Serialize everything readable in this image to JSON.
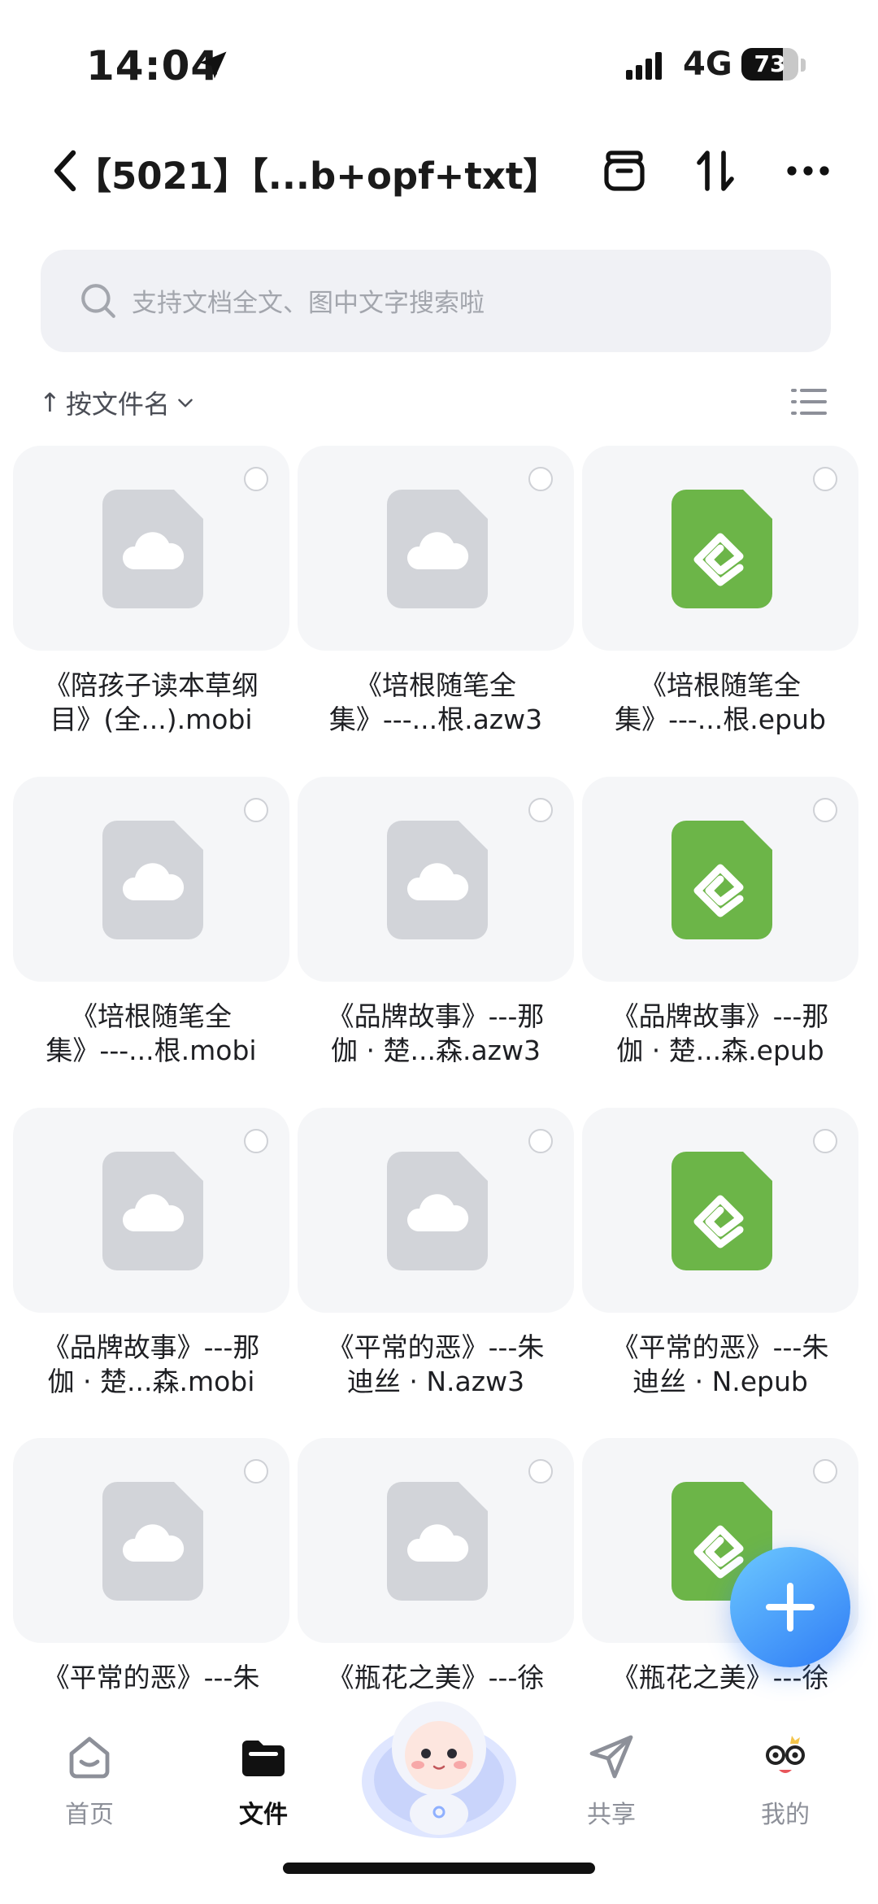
{
  "status": {
    "time": "14:04",
    "network": "4G",
    "battery": "73",
    "battery_level": 0.73
  },
  "header": {
    "title": "【5021】【...b+opf+txt】",
    "icons": [
      "back-chevron-icon",
      "archive-box-icon",
      "sort-arrows-icon",
      "more-dots-icon"
    ]
  },
  "search": {
    "placeholder": "支持文档全文、图中文字搜索啦"
  },
  "sortbar": {
    "arrow": "↑",
    "label": "按文件名"
  },
  "files": [
    {
      "name_line1": "《陪孩子读本草纲",
      "name_line2": "目》(全...).mobi",
      "type": "cloud"
    },
    {
      "name_line1": "《培根随笔全",
      "name_line2": "集》---...根.azw3",
      "type": "cloud"
    },
    {
      "name_line1": "《培根随笔全",
      "name_line2": "集》---...根.epub",
      "type": "epub"
    },
    {
      "name_line1": "《培根随笔全",
      "name_line2": "集》---...根.mobi",
      "type": "cloud"
    },
    {
      "name_line1": "《品牌故事》---那",
      "name_line2": "伽 · 楚...森.azw3",
      "type": "cloud"
    },
    {
      "name_line1": "《品牌故事》---那",
      "name_line2": "伽 · 楚...森.epub",
      "type": "epub"
    },
    {
      "name_line1": "《品牌故事》---那",
      "name_line2": "伽 · 楚...森.mobi",
      "type": "cloud"
    },
    {
      "name_line1": "《平常的恶》---朱",
      "name_line2": "迪丝 · N.azw3",
      "type": "cloud"
    },
    {
      "name_line1": "《平常的恶》---朱",
      "name_line2": "迪丝 · N.epub",
      "type": "epub"
    },
    {
      "name_line1": "《平常的恶》---朱",
      "name_line2": "",
      "type": "cloud"
    },
    {
      "name_line1": "《瓶花之美》---徐",
      "name_line2": "",
      "type": "cloud"
    },
    {
      "name_line1": "《瓶花之美》---徐",
      "name_line2": "",
      "type": "epub"
    }
  ],
  "nav": {
    "home": "首页",
    "files": "文件",
    "share": "共享",
    "mine": "我的"
  },
  "colors": {
    "accent": "#2f7cf6",
    "epub_green": "#6cb548",
    "tile_bg": "#f5f6f8"
  }
}
